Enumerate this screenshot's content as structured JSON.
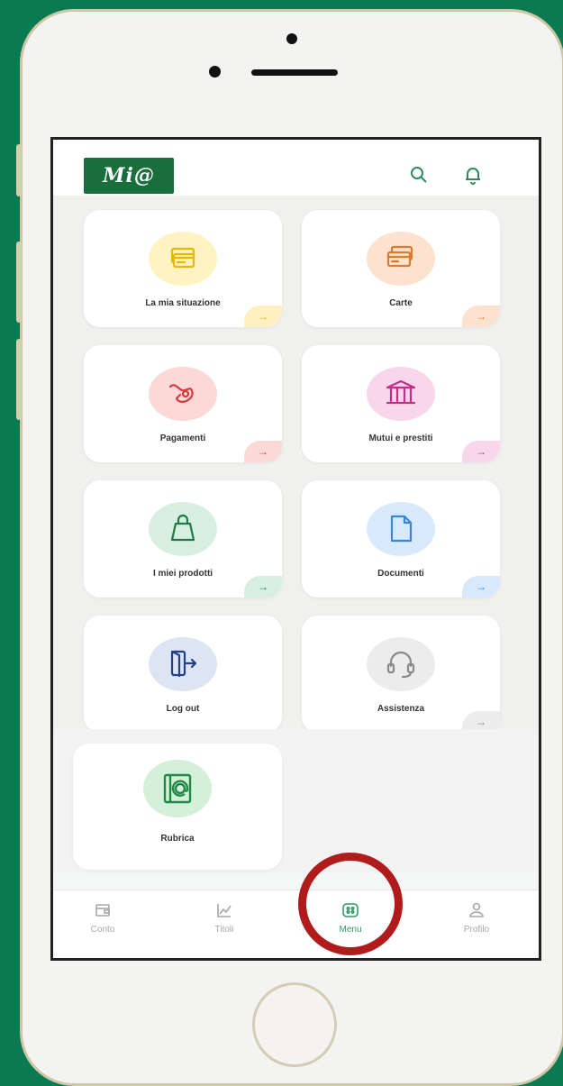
{
  "app": {
    "logo_text": "Mi@"
  },
  "header": {
    "icons": [
      "search-icon",
      "bell-icon"
    ]
  },
  "menu_cards": [
    {
      "label": "La mia situazione",
      "icon": "wallet-cards-icon",
      "circle_color": "#fff3c2",
      "icon_color": "#e6b800",
      "arrow_bg": "#fff0c2",
      "arrow_color": "#e6a800"
    },
    {
      "label": "Carte",
      "icon": "credit-cards-icon",
      "circle_color": "#fde3cf",
      "icon_color": "#e07a2b",
      "arrow_bg": "#fde3cf",
      "arrow_color": "#e07a2b"
    },
    {
      "label": "Pagamenti",
      "icon": "payment-hand-icon",
      "circle_color": "#fbd9d6",
      "icon_color": "#d9393a",
      "arrow_bg": "#fbd9d6",
      "arrow_color": "#d9393a"
    },
    {
      "label": "Mutui e prestiti",
      "icon": "bank-icon",
      "circle_color": "#f8d7ec",
      "icon_color": "#c22f88",
      "arrow_bg": "#f8d7ec",
      "arrow_color": "#c22f88"
    },
    {
      "label": "I miei prodotti",
      "icon": "shopping-bag-icon",
      "circle_color": "#d7efe0",
      "icon_color": "#1f7a45",
      "arrow_bg": "#d7efe0",
      "arrow_color": "#1f7a45"
    },
    {
      "label": "Documenti",
      "icon": "document-icon",
      "circle_color": "#d8e9fb",
      "icon_color": "#3a86d6",
      "arrow_bg": "#d8e9fb",
      "arrow_color": "#3a86d6"
    },
    {
      "label": "Log out",
      "icon": "logout-door-icon",
      "circle_color": "#dde5f2",
      "icon_color": "#23408e",
      "arrow_bg": "",
      "arrow_color": ""
    },
    {
      "label": "Assistenza",
      "icon": "headset-icon",
      "circle_color": "#ececec",
      "icon_color": "#8a8a8a",
      "arrow_bg": "#ececec",
      "arrow_color": "#8a8a8a"
    }
  ],
  "arrow_glyph": "→",
  "rubrica": {
    "label": "Rubrica",
    "icon": "address-book-icon"
  },
  "bottom_nav": [
    {
      "label": "Conto",
      "icon": "wallet-icon",
      "active": false
    },
    {
      "label": "Titoli",
      "icon": "chart-icon",
      "active": false
    },
    {
      "label": "Menu",
      "icon": "menu-grid-icon",
      "active": true
    },
    {
      "label": "Profilo",
      "icon": "user-icon",
      "active": false
    }
  ],
  "colors": {
    "brand_green": "#1a6e3c",
    "highlight_red": "#b01c1c",
    "background": "#0a7a52"
  }
}
